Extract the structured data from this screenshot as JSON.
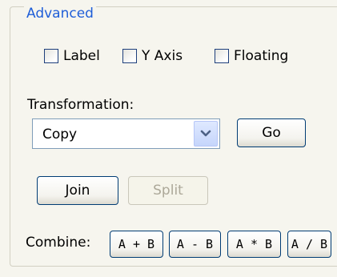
{
  "group": {
    "title": "Advanced"
  },
  "checkboxes": [
    {
      "label": "Label",
      "checked": false
    },
    {
      "label": "Y Axis",
      "checked": false
    },
    {
      "label": "Floating",
      "checked": false
    }
  ],
  "transformation": {
    "label": "Transformation:",
    "selected": "Copy",
    "go_label": "Go"
  },
  "buttons": {
    "join": "Join",
    "split": "Split"
  },
  "combine": {
    "label": "Combine:",
    "ops": [
      "A + B",
      "A - B",
      "A * B",
      "A / B"
    ]
  },
  "icons": {
    "dropdown": "chevron-down-icon"
  },
  "colors": {
    "legend": "#1f5ed8",
    "panel": "#f6f5ee",
    "button_border": "#003c74",
    "disabled_text": "#aca899",
    "dropdown_arrow": "#4d6185"
  }
}
